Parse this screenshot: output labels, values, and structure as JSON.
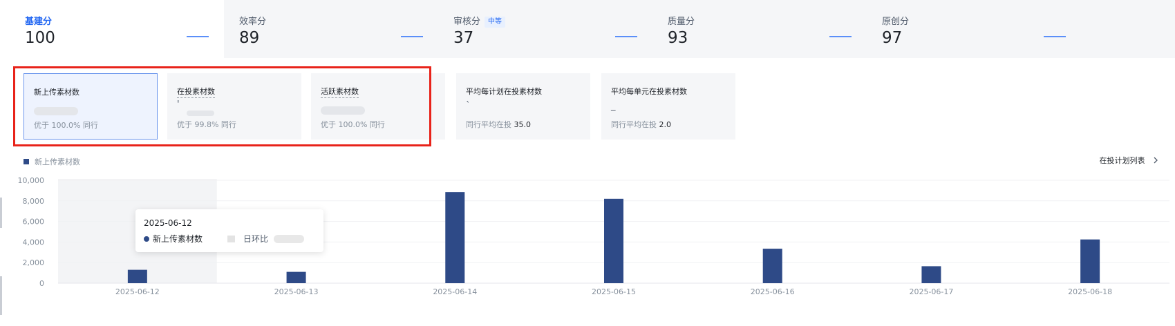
{
  "scores": [
    {
      "label": "基建分",
      "value": "100",
      "badge": ""
    },
    {
      "label": "效率分",
      "value": "89",
      "badge": ""
    },
    {
      "label": "审核分",
      "value": "37",
      "badge": "中等"
    },
    {
      "label": "质量分",
      "value": "93",
      "badge": ""
    },
    {
      "label": "原创分",
      "value": "97",
      "badge": ""
    }
  ],
  "cards": [
    {
      "title": "新上传素材数",
      "value": "",
      "sub_prefix": "优于 100.0% 同行",
      "sub_value": ""
    },
    {
      "title": "在投素材数",
      "value": "'",
      "sub_prefix": "优于 99.8% 同行",
      "sub_value": ""
    },
    {
      "title": "活跃素材数",
      "value": "",
      "sub_prefix": "优于 100.0% 同行",
      "sub_value": ""
    },
    {
      "title": "平均每计划在投素材数",
      "value": "`",
      "sub_prefix": "同行平均在投",
      "sub_value": "35.0"
    },
    {
      "title": "平均每单元在投素材数",
      "value": "_",
      "sub_prefix": "同行平均在投",
      "sub_value": "2.0"
    }
  ],
  "legend": {
    "label": "新上传素材数",
    "color": "#2e4a87"
  },
  "plan_list_link": "在投计划列表",
  "chevron_icon": "chevron-right-icon",
  "tooltip": {
    "date": "2025-06-12",
    "series_label": "新上传素材数",
    "compare_label": "日环比"
  },
  "chart_data": {
    "type": "bar",
    "categories": [
      "2025-06-12",
      "2025-06-13",
      "2025-06-14",
      "2025-06-15",
      "2025-06-16",
      "2025-06-17",
      "2025-06-18"
    ],
    "series": [
      {
        "name": "新上传素材数",
        "values": [
          1300,
          1100,
          8850,
          8200,
          3350,
          1650,
          4250
        ]
      }
    ],
    "ylim": [
      0,
      10000
    ],
    "yticks": [
      "0",
      "2,000",
      "4,000",
      "6,000",
      "8,000",
      "10,000"
    ],
    "ytick_values": [
      0,
      2000,
      4000,
      6000,
      8000,
      10000
    ],
    "legend": "top-left",
    "grid": true,
    "highlighted_category": "2025-06-12",
    "bar_color": "#2e4a87"
  }
}
